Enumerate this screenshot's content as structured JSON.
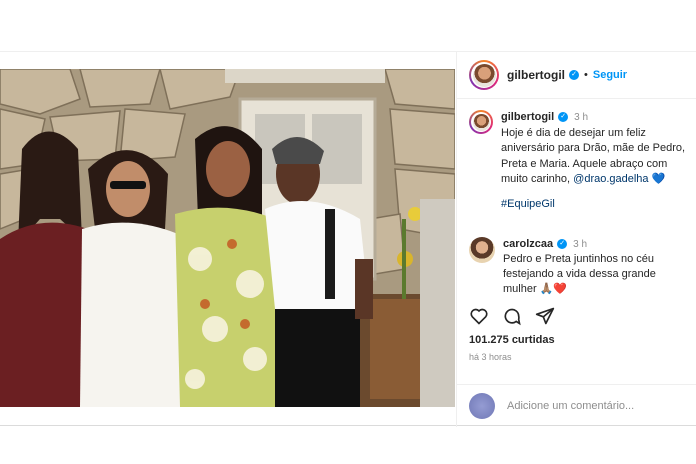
{
  "post": {
    "username": "gilbertogil",
    "follow_label": "Seguir",
    "separator": "•",
    "caption": {
      "username": "gilbertogil",
      "time": "3 h",
      "text": "Hoje é dia de desejar um feliz aniversário para Drão, mãe de Pedro, Preta e Maria. Aquele abraço com muito carinho,",
      "mention": "@drao.gadelha",
      "emoji": "💙",
      "hashtag": "#EquipeGil"
    },
    "comment": {
      "username": "carolzcaa",
      "time": "3 h",
      "text": "Pedro e Preta juntinhos no céu festejando a vida dessa grande mulher",
      "emoji": "🙏🏽❤️"
    },
    "likes": "101.275 curtidas",
    "timestamp": "há 3 horas",
    "comment_placeholder": "Adicione um comentário..."
  },
  "icons": [
    "heart-icon",
    "comment-icon",
    "share-icon",
    "verified-icon"
  ],
  "colors": {
    "link": "#0095f6",
    "verified": "#0095f6",
    "muted": "#8e8e8e",
    "text": "#262626"
  }
}
